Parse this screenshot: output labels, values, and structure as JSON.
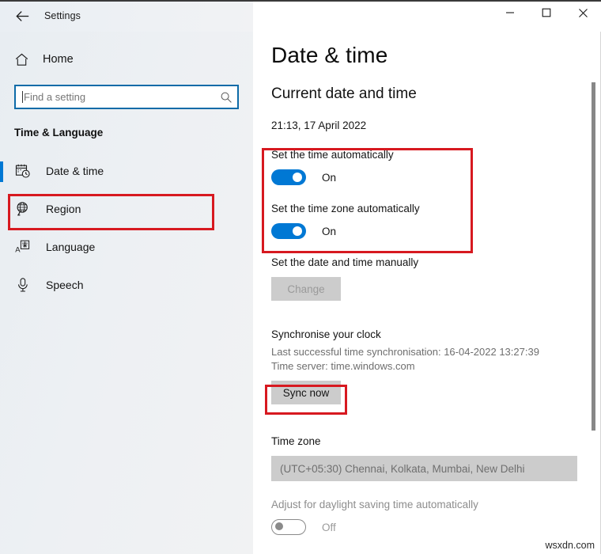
{
  "window": {
    "title": "Settings",
    "back_icon": "back-arrow-icon",
    "minimize_label": "—",
    "maximize_label": "□",
    "close_label": "✕"
  },
  "sidebar": {
    "home_label": "Home",
    "home_icon": "home-icon",
    "search": {
      "placeholder": "Find a setting",
      "value": "",
      "icon": "search-icon"
    },
    "section_title": "Time & Language",
    "items": [
      {
        "label": "Date & time",
        "icon": "calendar-clock-icon",
        "selected": true,
        "highlighted": true
      },
      {
        "label": "Region",
        "icon": "globe-icon",
        "selected": false,
        "highlighted": false
      },
      {
        "label": "Language",
        "icon": "language-icon",
        "selected": false,
        "highlighted": false
      },
      {
        "label": "Speech",
        "icon": "microphone-icon",
        "selected": false,
        "highlighted": false
      }
    ]
  },
  "main": {
    "page_title": "Date & time",
    "current_heading": "Current date and time",
    "current_value": "21:13, 17 April 2022",
    "set_time_auto": {
      "label": "Set the time automatically",
      "state": "On",
      "on": true
    },
    "set_timezone_auto": {
      "label": "Set the time zone automatically",
      "state": "On",
      "on": true
    },
    "manual": {
      "label": "Set the date and time manually",
      "button_label": "Change",
      "disabled": true
    },
    "sync": {
      "heading": "Synchronise your clock",
      "last_sync": "Last successful time synchronisation: 16-04-2022 13:27:39",
      "time_server": "Time server: time.windows.com",
      "button_label": "Sync now"
    },
    "timezone": {
      "heading": "Time zone",
      "selected": "(UTC+05:30) Chennai, Kolkata, Mumbai, New Delhi"
    },
    "dst": {
      "label": "Adjust for daylight saving time automatically",
      "state": "Off",
      "on": false
    }
  },
  "annotations": {
    "accent_color": "#0078d4",
    "highlight_color": "#d71920",
    "watermark": "wsxdn.com"
  }
}
